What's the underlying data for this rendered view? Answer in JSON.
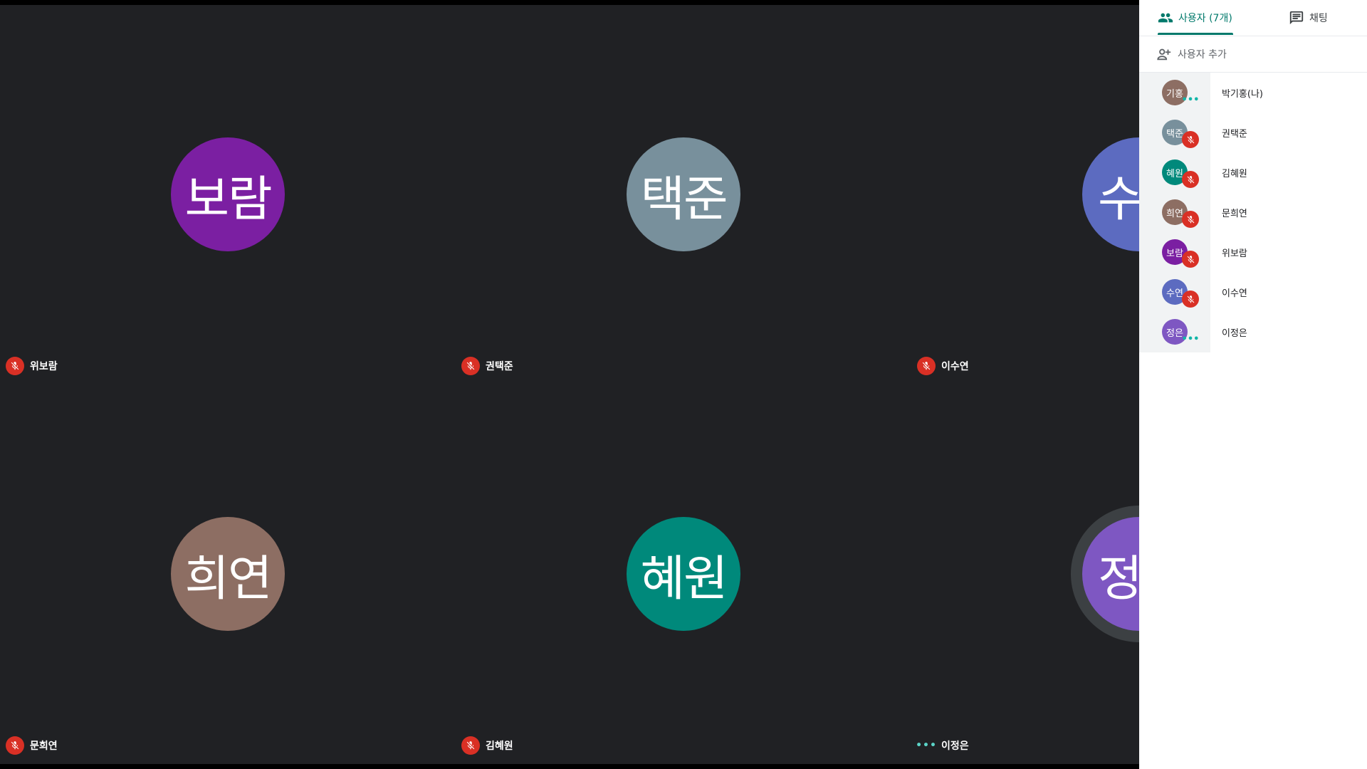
{
  "colors": {
    "accent": "#00796b",
    "mute": "#d93025",
    "stage_bg": "#202124",
    "panel_bg": "#ffffff"
  },
  "tiles": [
    {
      "initials": "보람",
      "name": "위보람",
      "color": "#7b1fa2",
      "status": "muted"
    },
    {
      "initials": "택준",
      "name": "권택준",
      "color": "#78909c",
      "status": "muted"
    },
    {
      "initials": "수",
      "name": "이수연",
      "color": "#5c6bc0",
      "status": "muted"
    },
    {
      "initials": "희연",
      "name": "문희연",
      "color": "#8d6e63",
      "status": "muted"
    },
    {
      "initials": "혜원",
      "name": "김혜원",
      "color": "#00897b",
      "status": "muted"
    },
    {
      "initials": "정",
      "name": "이정은",
      "color": "#7e57c2",
      "status": "speaking",
      "dots": "•••"
    }
  ],
  "panel": {
    "tab_people": "사용자 (7개)",
    "tab_chat": "채팅",
    "add_user": "사용자 추가",
    "people": [
      {
        "initials": "기홍",
        "name": "박기홍(나)",
        "color": "#8d6e63",
        "status": "dots",
        "dots": "•••"
      },
      {
        "initials": "택준",
        "name": "권택준",
        "color": "#78909c",
        "status": "muted"
      },
      {
        "initials": "혜원",
        "name": "김혜원",
        "color": "#00897b",
        "status": "muted"
      },
      {
        "initials": "희연",
        "name": "문희연",
        "color": "#8d6e63",
        "status": "muted"
      },
      {
        "initials": "보람",
        "name": "위보람",
        "color": "#7b1fa2",
        "status": "muted"
      },
      {
        "initials": "수연",
        "name": "이수연",
        "color": "#5c6bc0",
        "status": "muted"
      },
      {
        "initials": "정은",
        "name": "이정은",
        "color": "#7e57c2",
        "status": "dots",
        "dots": "•••"
      }
    ]
  },
  "icons": {
    "people_tab": "people-icon",
    "chat_tab": "chat-icon",
    "add_user": "person-add-icon",
    "muted": "mic-off-icon",
    "speaking": "more-dots-icon"
  }
}
